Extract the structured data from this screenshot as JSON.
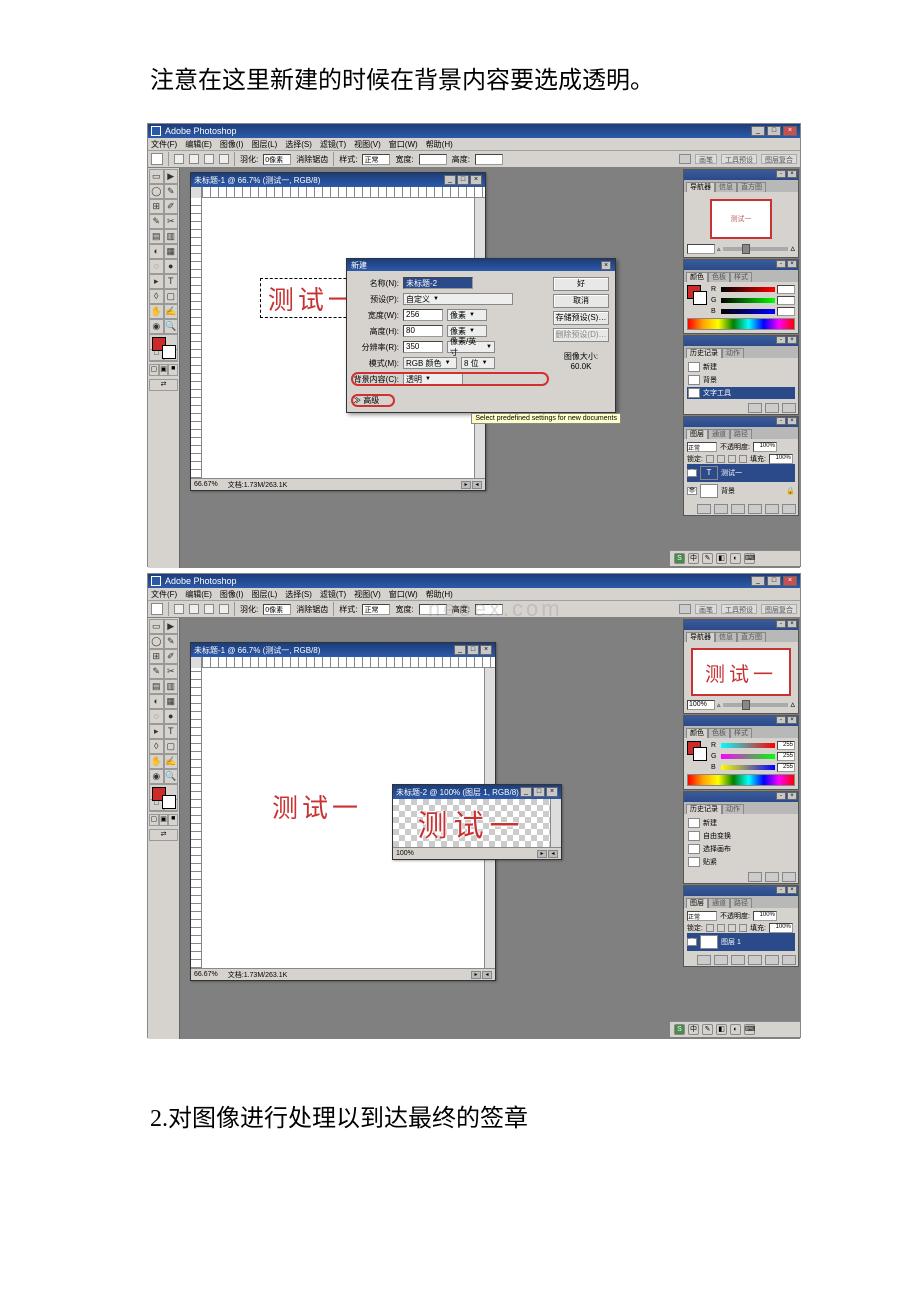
{
  "doc": {
    "line1": "注意在这里新建的时候在背景内容要选成透明。",
    "line2": "2.对图像进行处理以到达最终的签章"
  },
  "app": {
    "title": "Adobe Photoshop",
    "menus": [
      "文件(F)",
      "编辑(E)",
      "图像(I)",
      "图层(L)",
      "选择(S)",
      "滤镜(T)",
      "视图(V)",
      "窗口(W)",
      "帮助(H)"
    ]
  },
  "options1": {
    "labels": {
      "feather": "羽化:",
      "antialias": "消除锯齿",
      "style": "样式:",
      "width": "宽度:",
      "height": "高度:"
    },
    "feather": "0像素",
    "style": "正常"
  },
  "options2": {
    "mode": "正常",
    "feather": "0像素"
  },
  "right_tabs": {
    "brushes": "画笔",
    "tool_presets": "工具预设",
    "layer_comps": "图层复合"
  },
  "shot1": {
    "doc_title": "未标题-1 @ 66.7% (测试一, RGB/8)",
    "sample_text": "测试一",
    "status": {
      "zoom": "66.67%",
      "info": "文档:1.73M/263.1K"
    },
    "dialog": {
      "title": "新建",
      "name_label": "名称(N):",
      "name_value": "未标题-2",
      "preset_label": "预设(P):",
      "preset_value": "自定义",
      "width_label": "宽度(W):",
      "width_value": "256",
      "height_label": "高度(H):",
      "height_value": "80",
      "res_label": "分辨率(R):",
      "res_value": "350",
      "mode_label": "模式(M):",
      "mode_value": "RGB 颜色",
      "bits_value": "8 位",
      "bg_label": "背景内容(C):",
      "bg_value": "透明",
      "unit_px": "像素",
      "unit_ppi": "像素/英寸",
      "advanced": "≫ 高级",
      "imgsize_label": "图像大小:",
      "imgsize_value": "60.0K",
      "ok": "好",
      "cancel": "取消",
      "save_preset": "存储预设(S)…",
      "del_preset": "删除预设(D)…",
      "tooltip": "Select predefined settings for new documents"
    },
    "nav": {
      "tab": "导航器",
      "tab2": "信息",
      "tab3": "直方图",
      "sample": "测试一"
    },
    "color": {
      "tab": "颜色",
      "tab2": "色板",
      "tab3": "样式",
      "R": "R",
      "G": "G",
      "B": "B"
    },
    "history": {
      "tab": "历史记录",
      "tab2": "动作",
      "items": [
        "新建",
        "背景",
        "文字工具"
      ],
      "first_icon": "□"
    },
    "layers": {
      "tab": "图层",
      "tab2": "通道",
      "tab3": "路径",
      "mode": "正常",
      "opacity_label": "不透明度:",
      "opacity": "100%",
      "lock_label": "锁定:",
      "fill_label": "填充:",
      "fill": "100%",
      "layer_name": "测试一",
      "bg_name": "背景"
    }
  },
  "shot2": {
    "doc1_title": "未标题-1 @ 66.7% (测试一, RGB/8)",
    "doc2_title": "未标题-2 @ 100% (图层 1, RGB/8)",
    "sample_text": "测试一",
    "status1": {
      "zoom": "66.67%",
      "info": "文档:1.73M/263.1K"
    },
    "status2": {
      "zoom": "100%"
    },
    "nav": {
      "zoom": "100%"
    },
    "color": {
      "val": "255"
    },
    "history": {
      "tab": "历史记录",
      "tab2": "动作",
      "items": [
        "新建",
        "自由变换",
        "选择画布",
        "贴紧"
      ]
    },
    "layers": {
      "tab": "图层",
      "tab2": "通道",
      "tab3": "路径",
      "mode": "正常",
      "opacity_label": "不透明度:",
      "opacity": "100%",
      "lock_label": "锁定:",
      "fill_label": "填充:",
      "fill": "100%",
      "layer_name": "图层 1"
    }
  },
  "tools": [
    "▭",
    "▶",
    "◯",
    "✎",
    "⊞",
    "✐",
    "✎",
    "✂",
    "▤",
    "▥",
    "◐",
    "▦",
    "◌",
    "●",
    "▸",
    "T",
    "◊",
    "▢",
    "✋",
    "✍",
    "◉",
    "🔍"
  ],
  "colors": {
    "shot1_fg": "#cc2b2b",
    "shot1_bg": "#ffffff",
    "shot2_fg": "#cc2b2b",
    "shot2_bg": "#ffffff"
  },
  "watermark": "neoex.com"
}
